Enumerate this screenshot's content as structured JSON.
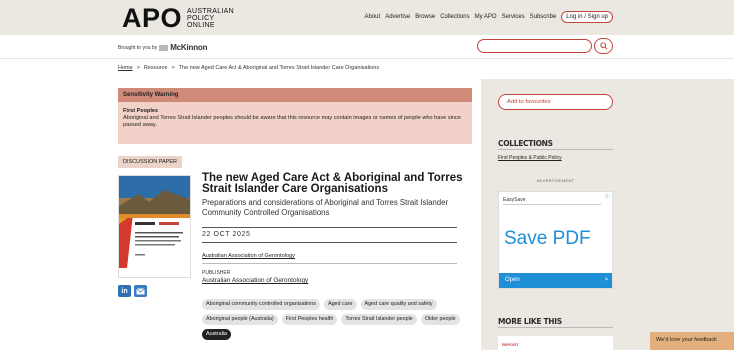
{
  "header": {
    "logo_main": "APO",
    "logo_sub": [
      "AUSTRALIAN",
      "POLICY",
      "ONLINE"
    ],
    "nav": [
      "About",
      "Advertise",
      "Browse",
      "Collections",
      "My APO",
      "Services",
      "Subscribe"
    ],
    "login": "Log in / Sign up"
  },
  "brand": {
    "brought_by": "Brought to you by",
    "sponsor": "McKinnon"
  },
  "breadcrumb": {
    "home": "Home",
    "sep": ">",
    "resource": "Resource",
    "current": "The new Aged Care Act & Aboriginal and Torres Strait Islander Care Organisations"
  },
  "warning": {
    "heading": "Sensitivity Warning",
    "title": "First Peoples",
    "text": "Aboriginal and Torres Strait Islander peoples should be aware that this resource may contain images or names of people who have since passed away."
  },
  "doc": {
    "type": "DISCUSSION PAPER",
    "title": "The new Aged Care Act & Aboriginal and Torres Strait Islander Care Organisations",
    "subtitle": "Preparations and considerations of Aboriginal and Torres Strait Islander Community Controlled Organisations",
    "date": "22 OCT 2025",
    "author": "Australian Association of Gerontology",
    "publisher_label": "PUBLISHER",
    "publisher": "Australian Association of Gerontology"
  },
  "share": {
    "linkedin": "in"
  },
  "tags": [
    "Aboriginal community controlled organisations",
    "Aged care",
    "Aged care quality and safety",
    "Aboriginal people (Australia)",
    "First Peoples health",
    "Torres Strait Islander people",
    "Older people",
    "Australia"
  ],
  "sidebar": {
    "favourites": "Add to favourites",
    "collections_heading": "COLLECTIONS",
    "collection_item": "First Peoples & Public Policy",
    "ad_label": "ADVERTISEMENT",
    "ad_brand": "EasySave",
    "ad_headline": "Save PDF",
    "ad_cta": "Open",
    "ad_cta_arrow": ">",
    "more_heading": "MORE LIKE THIS",
    "report_tag": "REPORT"
  },
  "feedback": "We'd love your feedback",
  "colors": {
    "accent": "#c4443a",
    "warning_head": "#cf8a78",
    "warning_body": "#f2d2c8",
    "sidebar": "#ebe8e1",
    "ad_blue": "#1f8fd6"
  }
}
